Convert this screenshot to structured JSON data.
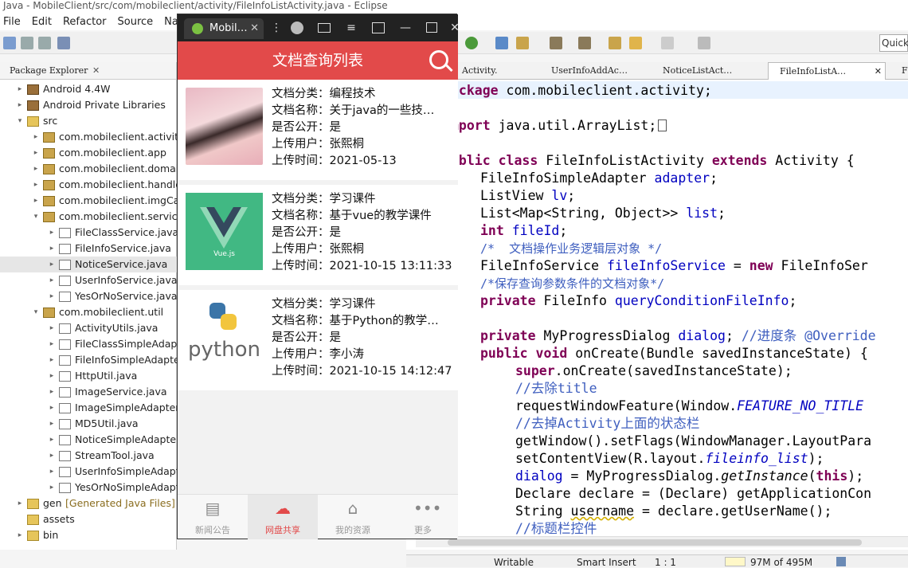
{
  "window": {
    "title": "Java - MobileClient/src/com/mobileclient/activity/FileInfoListActivity.java - Eclipse"
  },
  "menu": [
    "File",
    "Edit",
    "Refactor",
    "Source",
    "Navigate"
  ],
  "quick_access": "Quick",
  "package_explorer": {
    "title": "Package Explorer",
    "items": [
      {
        "label": "Android 4.4W"
      },
      {
        "label": "Android Private Libraries"
      },
      {
        "label": "src"
      },
      {
        "label": "com.mobileclient.activity"
      },
      {
        "label": "com.mobileclient.app"
      },
      {
        "label": "com.mobileclient.domain"
      },
      {
        "label": "com.mobileclient.handler"
      },
      {
        "label": "com.mobileclient.imgCac"
      },
      {
        "label": "com.mobileclient.service"
      },
      {
        "label": "FileClassService.java"
      },
      {
        "label": "FileInfoService.java"
      },
      {
        "label": "NoticeService.java"
      },
      {
        "label": "UserInfoService.java"
      },
      {
        "label": "YesOrNoService.java"
      },
      {
        "label": "com.mobileclient.util"
      },
      {
        "label": "ActivityUtils.java"
      },
      {
        "label": "FileClassSimpleAdapte"
      },
      {
        "label": "FileInfoSimpleAdapter"
      },
      {
        "label": "HttpUtil.java"
      },
      {
        "label": "ImageService.java"
      },
      {
        "label": "ImageSimpleAdapter."
      },
      {
        "label": "MD5Util.java"
      },
      {
        "label": "NoticeSimpleAdapter."
      },
      {
        "label": "StreamTool.java"
      },
      {
        "label": "UserInfoSimpleAdapte"
      },
      {
        "label": "YesOrNoSimpleAdapt"
      },
      {
        "label": "gen"
      },
      {
        "label": "assets"
      },
      {
        "label": "bin"
      }
    ],
    "gen_suffix": "[Generated Java Files]"
  },
  "editor_tabs": [
    "Activity.",
    "UserInfoAddAc…",
    "NoticeListAct…",
    "FileInfoListA…",
    "F"
  ],
  "code": {
    "l1a": "package",
    " l1b": "",
    "pkg": "com.mobileclient.activity;",
    "import_kw": "mport",
    "import_rest": " java.util.ArrayList;",
    "c_kw1": "ublic class",
    "c_name": " FileInfoListActivity ",
    "c_kw2": "extends",
    "c_rest": " Activity {",
    "f1a": "FileInfoSimpleAdapter ",
    "f1b": "adapter",
    "f2a": "ListView ",
    "f2b": "lv",
    "f3a": "List<Map<String, Object>> ",
    "f3b": "list",
    "f4kw": "int ",
    "f4b": "fileId",
    "cm1": "/*  文档操作业务逻辑层对象 */",
    "f5a": "FileInfoService ",
    "f5b": "fileInfoService",
    "f5c": " = ",
    "f5kw": "new",
    "f5d": " FileInfoSer",
    "cm2": "/*保存查询参数条件的文档对象*/",
    "f6kw": "private",
    "f6a": " FileInfo ",
    "f6b": "queryConditionFileInfo",
    "f7kw": "private",
    "f7a": " MyProgressDialog ",
    "f7b": "dialog",
    "f7c": "; ",
    "f7cm": "//进度条 @Override",
    "m1kw": "public void",
    "m1a": " onCreate(Bundle savedInstanceState) {",
    "m2kw": "super",
    "m2a": ".onCreate(savedInstanceState);",
    "cm3": "//去除title",
    "m3a": "requestWindowFeature(Window.",
    "m3b": "FEATURE_NO_TITLE",
    "cm4": "//去掉Activity上面的状态栏",
    "m4a": "getWindow().setFlags(WindowManager.LayoutPara",
    "m5a": "setContentView(R.layout.",
    "m5b": "fileinfo_list",
    "m5c": ");",
    "m6a": "dialog",
    "m6b": " = MyProgressDialog.",
    "m6c": "getInstance",
    "m6d": "(",
    "m6kw": "this",
    "m6e": ");",
    "m7a": "Declare declare = (Declare) getApplicationCon",
    "m8a": "String ",
    "m8b": "username",
    "m8c": " = declare.getUserName();",
    "cm5": "//标题栏控件"
  },
  "status": {
    "writable": "Writable",
    "insert": "Smart Insert",
    "pos": "1 : 1",
    "heap": "97M of 495M"
  },
  "emulator": {
    "tab_label": "Mobil…",
    "app_title": "文档查询列表",
    "items": [
      {
        "c": "文档分类：编程技术",
        "n": "文档名称：关于java的一些技…",
        "p": "是否公开：是",
        "u": "上传用户：张熙桐",
        "t": "上传时间：2021-05-13",
        "thumb": "photo"
      },
      {
        "c": "文档分类：学习课件",
        "n": "文档名称：基于vue的教学课件",
        "p": "是否公开：是",
        "u": "上传用户：张熙桐",
        "t": "上传时间：2021-10-15 13:11:33",
        "thumb": "vue",
        "thumb_text": "Vue.js"
      },
      {
        "c": "文档分类：学习课件",
        "n": "文档名称：基于Python的教学…",
        "p": "是否公开：是",
        "u": "上传用户：李小涛",
        "t": "上传时间：2021-10-15 14:12:47",
        "thumb": "python",
        "thumb_text": "python"
      }
    ],
    "nav": [
      {
        "label": "新闻公告",
        "icon": "film-icon"
      },
      {
        "label": "网盘共享",
        "icon": "cloud-share-icon"
      },
      {
        "label": "我的资源",
        "icon": "bookmark-icon"
      },
      {
        "label": "更多",
        "icon": "more-icon"
      }
    ],
    "accent": "#e24a4a"
  }
}
